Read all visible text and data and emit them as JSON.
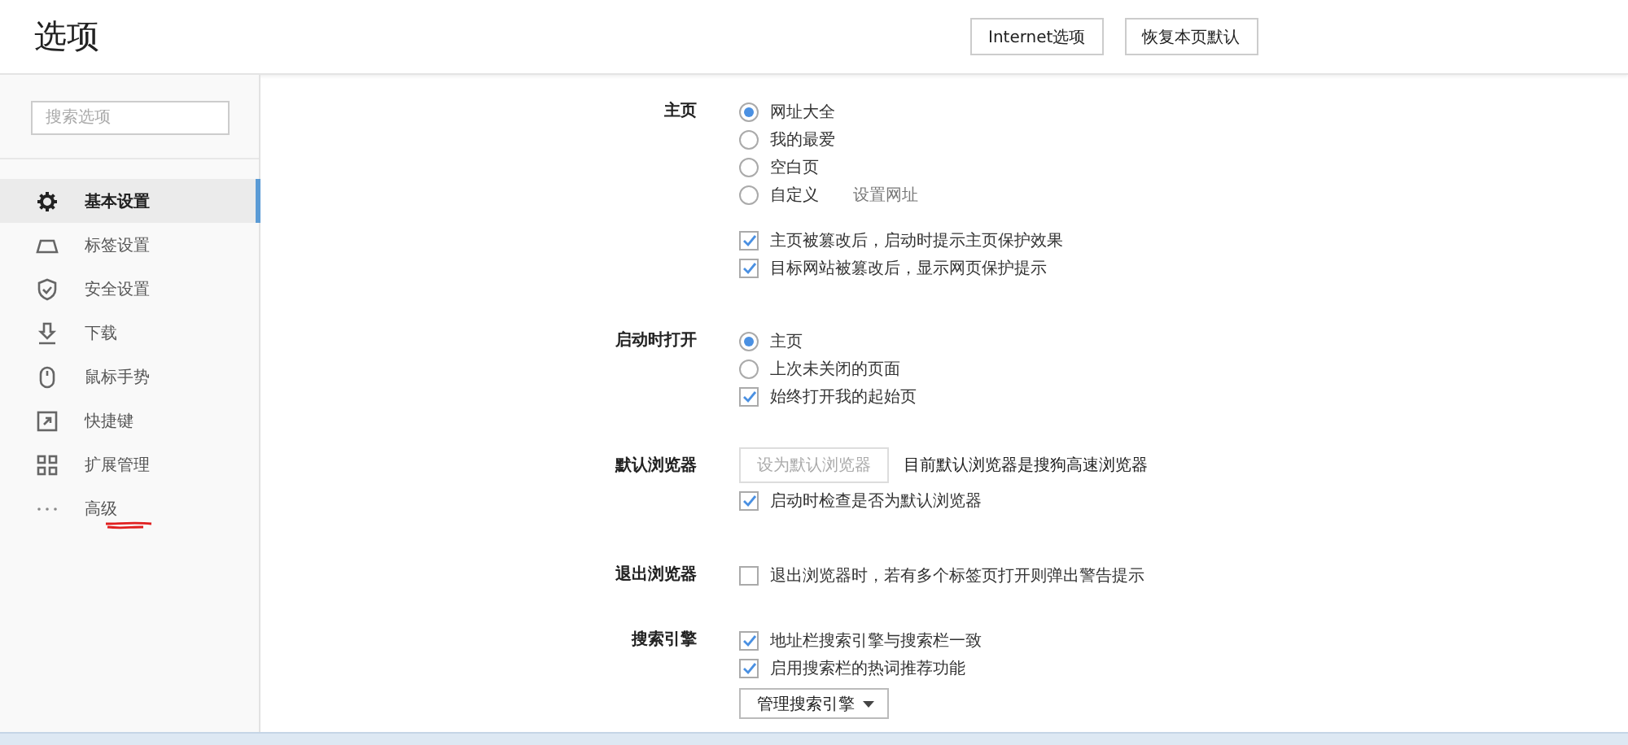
{
  "header": {
    "title": "选项",
    "buttons": [
      "Internet选项",
      "恢复本页默认"
    ]
  },
  "sidebar": {
    "search": {
      "placeholder": "搜索选项"
    },
    "items": [
      {
        "label": "基本设置",
        "selected": true,
        "annotated": false
      },
      {
        "label": "标签设置",
        "selected": false,
        "annotated": false
      },
      {
        "label": "安全设置",
        "selected": false,
        "annotated": false
      },
      {
        "label": "下载",
        "selected": false,
        "annotated": false
      },
      {
        "label": "鼠标手势",
        "selected": false,
        "annotated": false
      },
      {
        "label": "快捷键",
        "selected": false,
        "annotated": false
      },
      {
        "label": "扩展管理",
        "selected": false,
        "annotated": false
      },
      {
        "label": "高级",
        "selected": false,
        "annotated": true
      }
    ]
  },
  "sections": [
    {
      "label": "主页",
      "items": [
        {
          "kind": "radio",
          "label": "网址大全",
          "selected": true
        },
        {
          "kind": "radio",
          "label": "我的最爱",
          "selected": false
        },
        {
          "kind": "radio",
          "label": "空白页",
          "selected": false
        },
        {
          "kind": "radio",
          "label": "自定义",
          "selected": false,
          "link": "设置网址"
        },
        {
          "kind": "gap"
        },
        {
          "kind": "checkbox",
          "label": "主页被篡改后，启动时提示主页保护效果",
          "checked": true
        },
        {
          "kind": "checkbox",
          "label": "目标网站被篡改后，显示网页保护提示",
          "checked": true
        }
      ]
    },
    {
      "label": "启动时打开",
      "items": [
        {
          "kind": "radio",
          "label": "主页",
          "selected": true
        },
        {
          "kind": "radio",
          "label": "上次未关闭的页面",
          "selected": false
        },
        {
          "kind": "checkbox",
          "label": "始终打开我的起始页",
          "checked": true
        }
      ]
    },
    {
      "label": "默认浏览器",
      "items": [
        {
          "kind": "button",
          "label": "设为默认浏览器",
          "disabled": true,
          "note": "目前默认浏览器是搜狗高速浏览器"
        },
        {
          "kind": "checkbox",
          "label": "启动时检查是否为默认浏览器",
          "checked": true
        }
      ]
    },
    {
      "label": "退出浏览器",
      "items": [
        {
          "kind": "checkbox",
          "label": "退出浏览器时，若有多个标签页打开则弹出警告提示",
          "checked": false
        }
      ]
    },
    {
      "label": "搜索引擎",
      "items": [
        {
          "kind": "checkbox",
          "label": "地址栏搜索引擎与搜索栏一致",
          "checked": true
        },
        {
          "kind": "checkbox",
          "label": "启用搜索栏的热词推荐功能",
          "checked": true
        },
        {
          "kind": "dropdown",
          "label": "管理搜索引擎"
        }
      ]
    }
  ]
}
